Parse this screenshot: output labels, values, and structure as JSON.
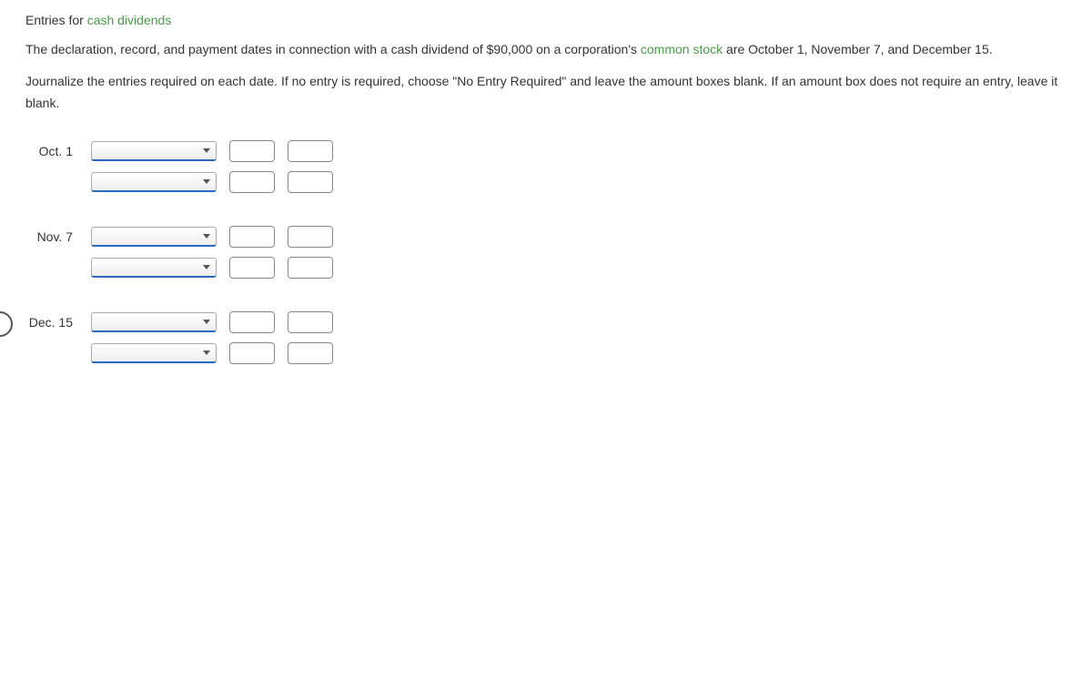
{
  "title": {
    "prefix": "Entries for ",
    "link": "cash dividends"
  },
  "para1": {
    "part1": "The declaration, record, and payment dates in connection with a cash dividend of $90,000 on a corporation's ",
    "link": "common stock",
    "part2": " are October 1, November 7, and December 15."
  },
  "para2": "Journalize the entries required on each date. If no entry is required, choose \"No Entry Required\" and leave the amount boxes blank. If an amount box does not require an entry, leave it blank.",
  "dates": {
    "d1": "Oct. 1",
    "d2": "Nov. 7",
    "d3": "Dec. 15"
  }
}
